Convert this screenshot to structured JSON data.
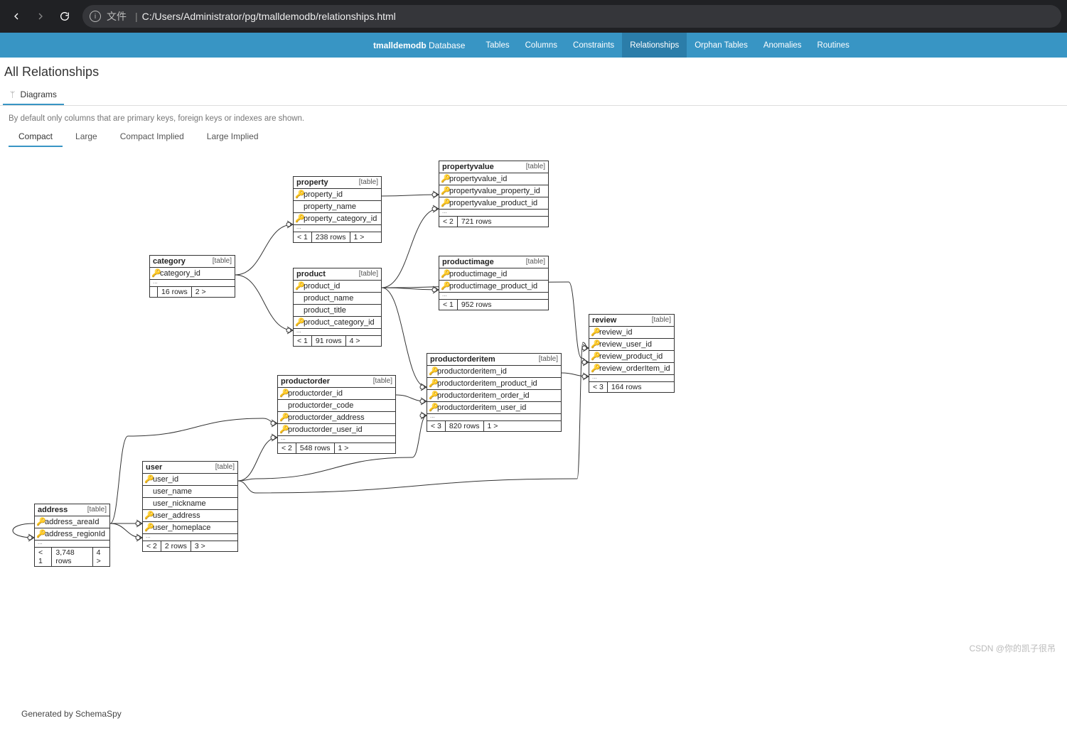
{
  "browser": {
    "file_label": "文件",
    "url": "C:/Users/Administrator/pg/tmalldemodb/relationships.html"
  },
  "header": {
    "brand_bold": "tmalldemodb",
    "brand_rest": " Database",
    "tabs": [
      "Tables",
      "Columns",
      "Constraints",
      "Relationships",
      "Orphan Tables",
      "Anomalies",
      "Routines"
    ],
    "active_tab": "Relationships"
  },
  "page": {
    "title": "All Relationships",
    "diagrams_tab": "Diagrams",
    "info_text": "By default only columns that are primary keys, foreign keys or indexes are shown.",
    "view_modes": [
      "Compact",
      "Large",
      "Compact Implied",
      "Large Implied"
    ],
    "active_view": "Compact",
    "generated_by": "Generated by SchemaSpy"
  },
  "watermark": "CSDN @你的凯子很吊",
  "tables": {
    "category": {
      "name": "category",
      "type": "[table]",
      "rows": [
        {
          "k": "pk",
          "n": "category_id"
        }
      ],
      "footer": [
        "",
        "16 rows",
        "2 >"
      ]
    },
    "property": {
      "name": "property",
      "type": "[table]",
      "rows": [
        {
          "k": "pk",
          "n": "property_id"
        },
        {
          "k": "",
          "n": "property_name"
        },
        {
          "k": "fk",
          "n": "property_category_id"
        }
      ],
      "footer": [
        "< 1",
        "238 rows",
        "1 >"
      ]
    },
    "product": {
      "name": "product",
      "type": "[table]",
      "rows": [
        {
          "k": "pk",
          "n": "product_id"
        },
        {
          "k": "",
          "n": "product_name"
        },
        {
          "k": "",
          "n": "product_title"
        },
        {
          "k": "fk",
          "n": "product_category_id"
        }
      ],
      "footer": [
        "< 1",
        "91 rows",
        "4 >"
      ]
    },
    "propertyvalue": {
      "name": "propertyvalue",
      "type": "[table]",
      "rows": [
        {
          "k": "pk",
          "n": "propertyvalue_id"
        },
        {
          "k": "fk",
          "n": "propertyvalue_property_id"
        },
        {
          "k": "fk",
          "n": "propertyvalue_product_id"
        }
      ],
      "footer": [
        "< 2",
        "721 rows"
      ]
    },
    "productimage": {
      "name": "productimage",
      "type": "[table]",
      "rows": [
        {
          "k": "pk",
          "n": "productimage_id"
        },
        {
          "k": "fk",
          "n": "productimage_product_id"
        }
      ],
      "footer": [
        "< 1",
        "952 rows"
      ]
    },
    "productorder": {
      "name": "productorder",
      "type": "[table]",
      "rows": [
        {
          "k": "pk",
          "n": "productorder_id"
        },
        {
          "k": "",
          "n": "productorder_code"
        },
        {
          "k": "fk",
          "n": "productorder_address"
        },
        {
          "k": "fk",
          "n": "productorder_user_id"
        }
      ],
      "footer": [
        "< 2",
        "548 rows",
        "1 >"
      ]
    },
    "productorderitem": {
      "name": "productorderitem",
      "type": "[table]",
      "rows": [
        {
          "k": "pk",
          "n": "productorderitem_id"
        },
        {
          "k": "fk",
          "n": "productorderitem_product_id"
        },
        {
          "k": "fk",
          "n": "productorderitem_order_id"
        },
        {
          "k": "fk",
          "n": "productorderitem_user_id"
        }
      ],
      "footer": [
        "< 3",
        "820 rows",
        "1 >"
      ]
    },
    "review": {
      "name": "review",
      "type": "[table]",
      "rows": [
        {
          "k": "pk",
          "n": "review_id"
        },
        {
          "k": "fk",
          "n": "review_user_id"
        },
        {
          "k": "fk",
          "n": "review_product_id"
        },
        {
          "k": "fk",
          "n": "review_orderItem_id"
        }
      ],
      "footer": [
        "< 3",
        "164 rows"
      ]
    },
    "user": {
      "name": "user",
      "type": "[table]",
      "rows": [
        {
          "k": "pk",
          "n": "user_id"
        },
        {
          "k": "",
          "n": "user_name"
        },
        {
          "k": "",
          "n": "user_nickname"
        },
        {
          "k": "fk",
          "n": "user_address"
        },
        {
          "k": "fk",
          "n": "user_homeplace"
        }
      ],
      "footer": [
        "< 2",
        "2 rows",
        "3 >"
      ]
    },
    "address": {
      "name": "address",
      "type": "[table]",
      "rows": [
        {
          "k": "pk",
          "n": "address_areaId"
        },
        {
          "k": "fk",
          "n": "address_regionId"
        }
      ],
      "footer": [
        "< 1",
        "3,748 rows",
        "4 >"
      ]
    }
  }
}
